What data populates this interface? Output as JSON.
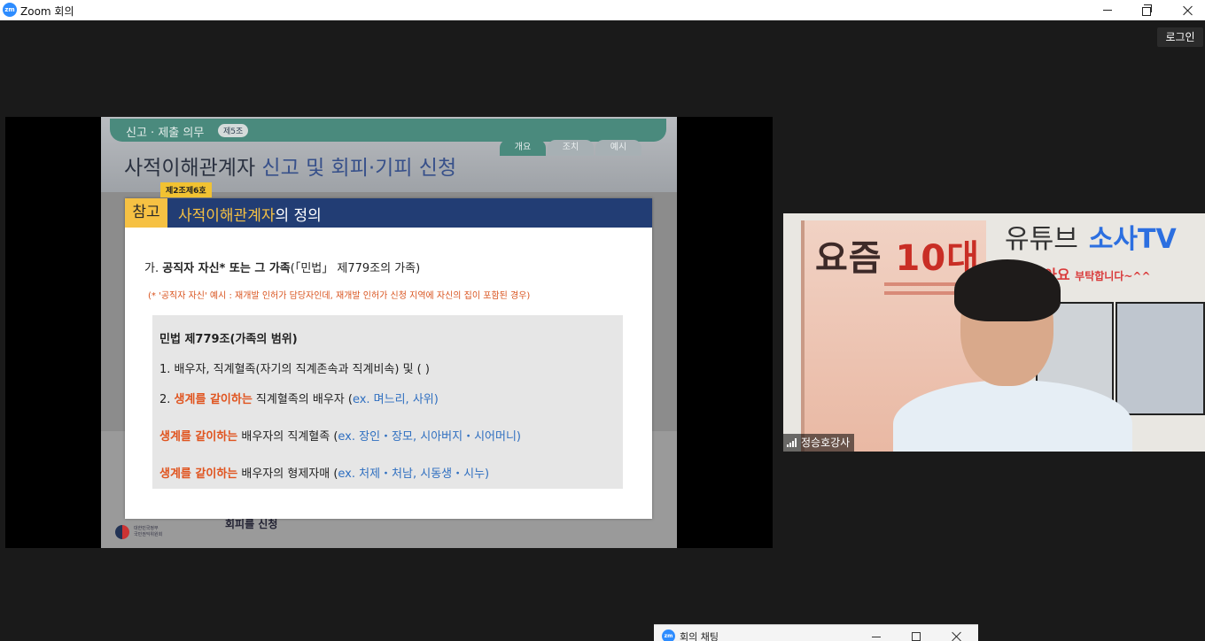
{
  "window": {
    "logo_text": "zm",
    "title": "Zoom 회의"
  },
  "header": {
    "login_label": "로그인"
  },
  "slide": {
    "section_label": "신고 · 제출 의무",
    "section_tag": "제5조",
    "tabs": [
      "개요",
      "조치",
      "예시"
    ],
    "heading_prefix": "사적이해관계자",
    "heading_highlight": " 신고 및 회피·기피 신청",
    "footer_text": "회피를 신청",
    "logo_text_line1": "대한민국정부",
    "logo_text_line2": "국민권익위원회",
    "card": {
      "tag": "제2조제6호",
      "header_left": "참고",
      "header_title_yellow": "사적이해관계자",
      "header_title_rest": "의 정의",
      "line1_prefix": "가. ",
      "line1_bold": "공직자 자신* 또는 그 가족",
      "line1_rest": "(「민법」 제779조의 가족)",
      "note": "(* '공직자 자신' 예시 : 재개발 인허가 담당자인데, 재개발 인허가 신청 지역에 자신의 집이 포함된 경우)",
      "law": {
        "title": "민법 제779조(가족의 범위)",
        "item1": "1. 배우자, 직계혈족(자기의 직계존속과 직계비속) 및 (                )",
        "item2_prefix": "2. ",
        "item2_org": "생계를 같이하는",
        "item2_rest": " 직계혈족의 배우자 (",
        "item2_blue": "ex. 며느리, 사위",
        "item2_end": ")",
        "item3_org": "생계를 같이하는",
        "item3_rest": " 배우자의 직계혈족 (",
        "item3_blue": "ex. 장인・장모, 시아버지・시어머니",
        "item3_end": ")",
        "item4_org": "생계를 같이하는",
        "item4_rest": " 배우자의 형제자매 (",
        "item4_blue": "ex. 처제・처남, 시동생・시누",
        "item4_end": ")"
      }
    }
  },
  "video": {
    "participant_name": "정승호강사",
    "book_title_a": "요즘 ",
    "book_title_b": "10대",
    "youtube_label": "유튜브",
    "channel_label": "소사TV",
    "like_text": "구독・좋아요 ",
    "like_small": "부탁합니다~^^"
  },
  "chat": {
    "logo_text": "zm",
    "title": "회의 채팅"
  }
}
